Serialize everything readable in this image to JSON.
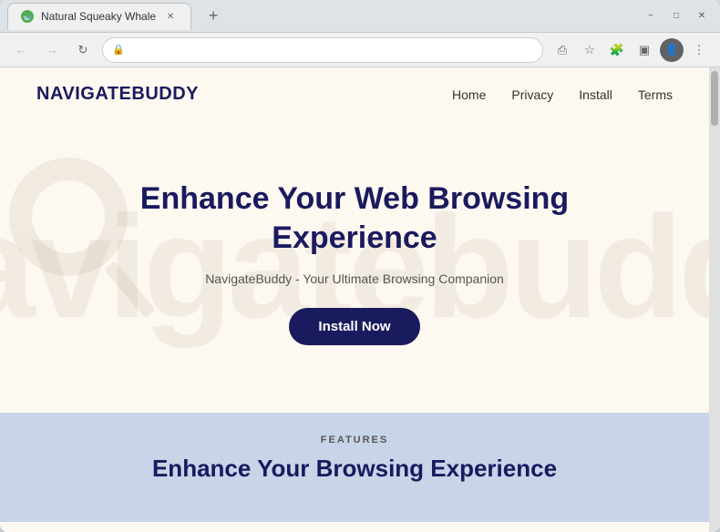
{
  "browser": {
    "tab_title": "Natural Squeaky Whale",
    "tab_favicon": "🐋",
    "url": "",
    "window_controls": {
      "minimize": "−",
      "maximize": "□",
      "close": "✕"
    },
    "nav": {
      "back": "←",
      "forward": "→",
      "refresh": "↻"
    }
  },
  "site": {
    "logo": "NAVIGATEBUDDY",
    "nav_items": [
      {
        "label": "Home",
        "href": "#"
      },
      {
        "label": "Privacy",
        "href": "#"
      },
      {
        "label": "Install",
        "href": "#"
      },
      {
        "label": "Terms",
        "href": "#"
      }
    ],
    "hero": {
      "title": "Enhance Your Web Browsing Experience",
      "subtitle": "NavigateBuddy - Your Ultimate Browsing Companion",
      "cta_label": "Install Now"
    },
    "features": {
      "section_label": "FEATURES",
      "section_title": "Enhance Your Browsing Experience"
    },
    "watermark_text": "navigatebuddy"
  }
}
